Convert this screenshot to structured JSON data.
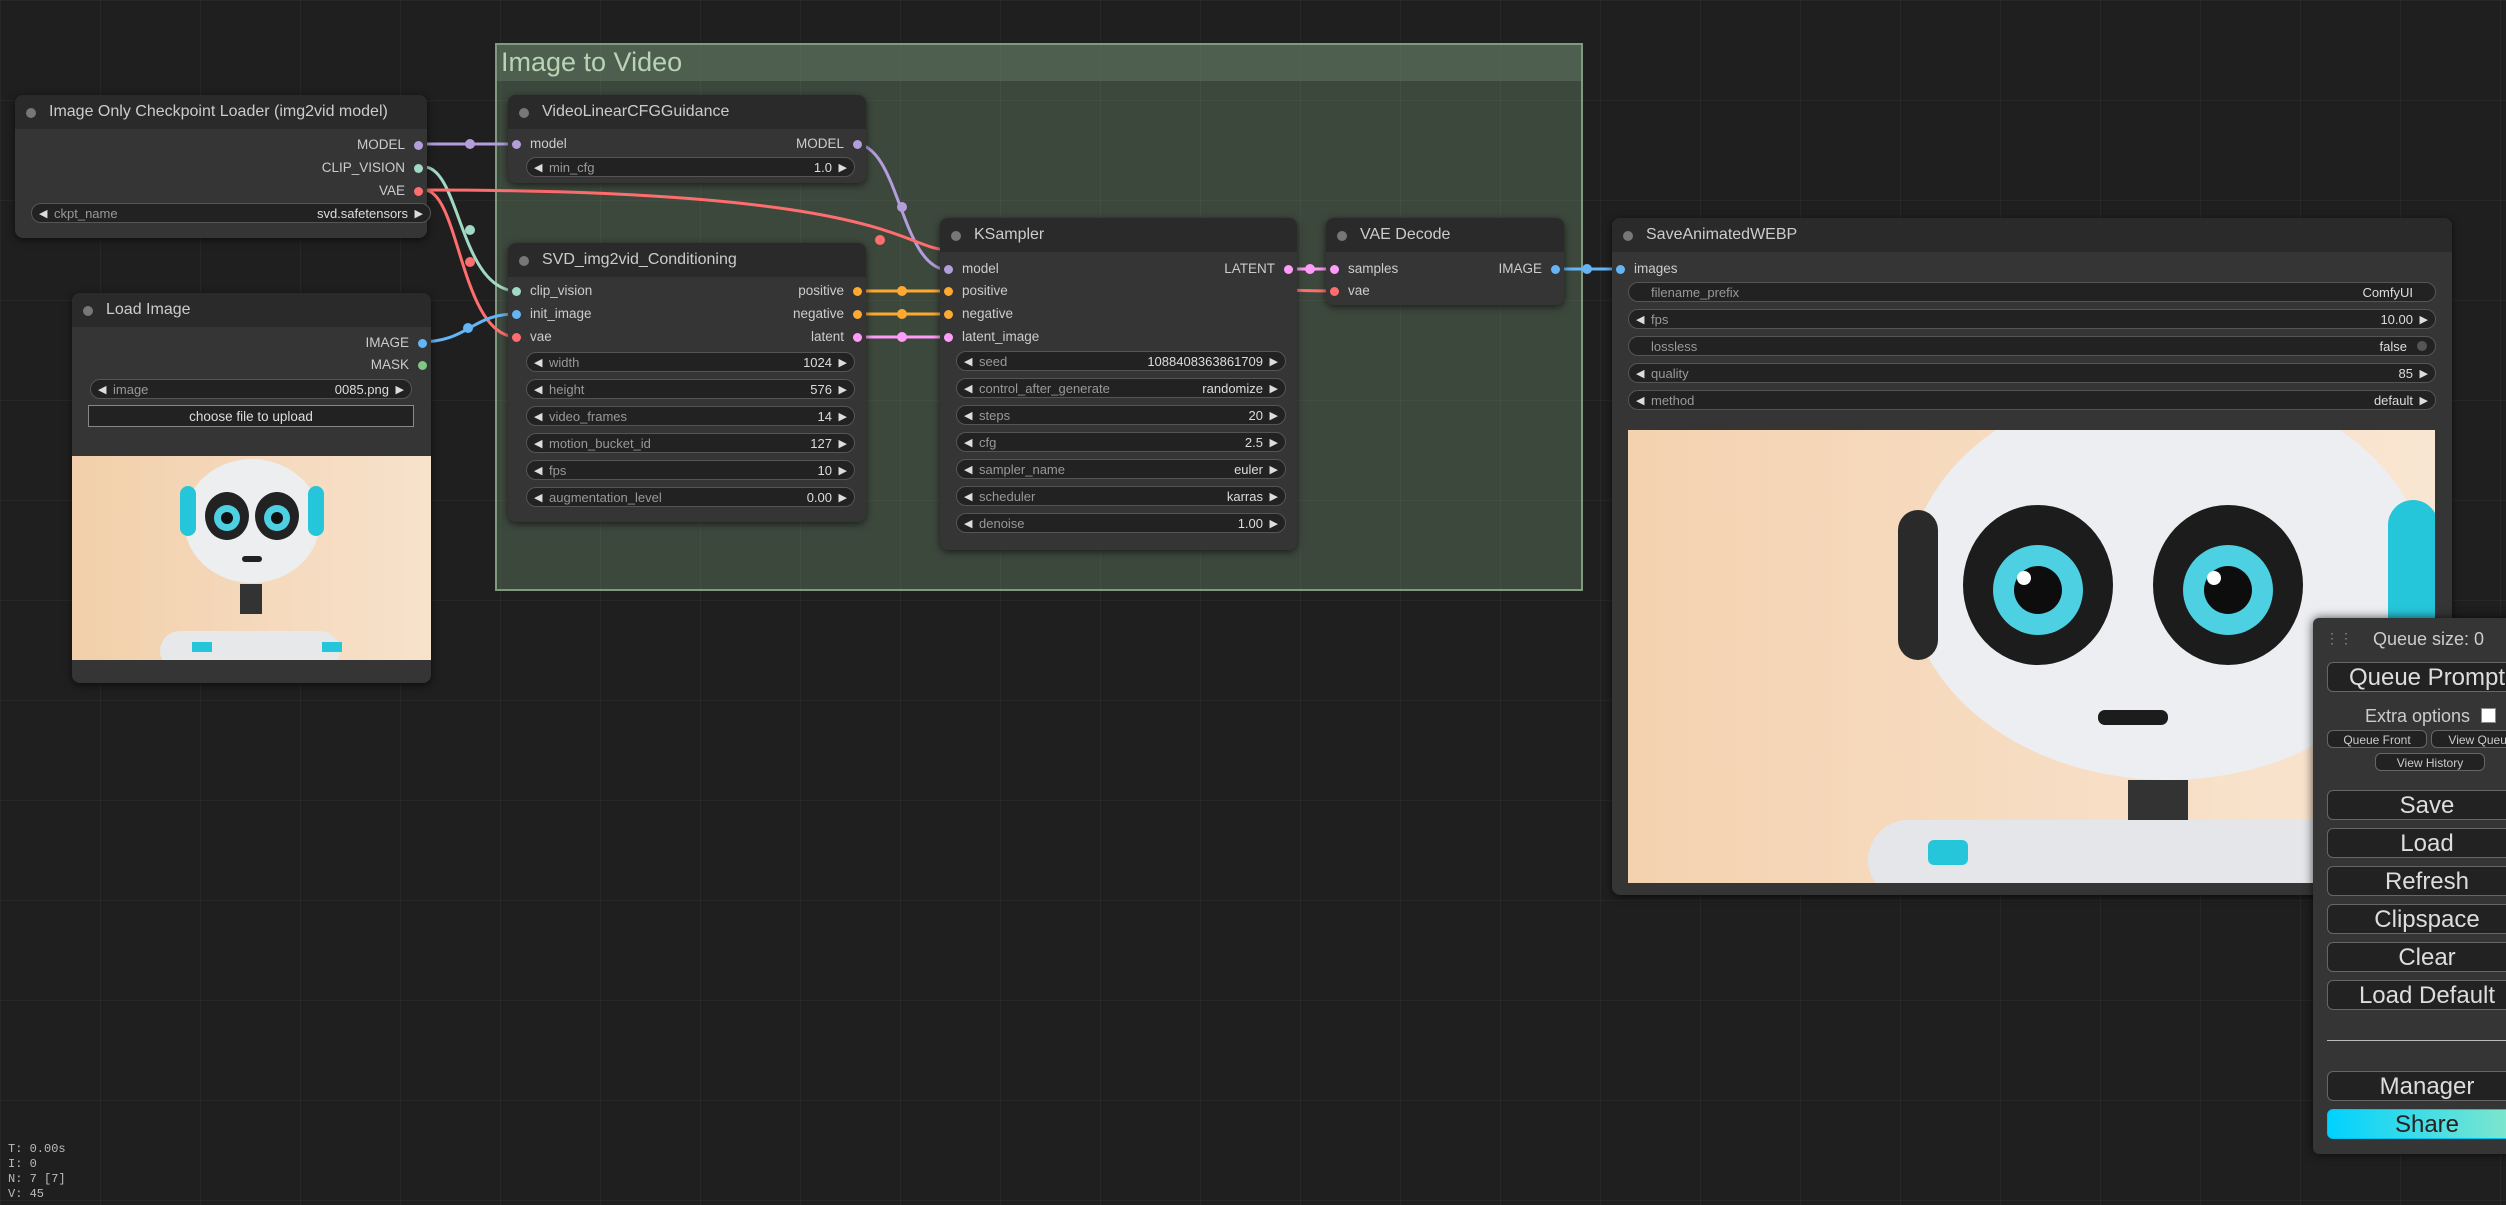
{
  "group": {
    "title": "Image to Video"
  },
  "colors": {
    "model": "#b39ddb",
    "clip_vision": "#a1d9c4",
    "vae": "#ff6e6e",
    "image": "#64b5f6",
    "conditioning": "#ffa931",
    "latent": "#ff9cf9",
    "mask": "#81c784"
  },
  "checkpoint": {
    "title": "Image Only Checkpoint Loader (img2vid model)",
    "outputs": [
      "MODEL",
      "CLIP_VISION",
      "VAE"
    ],
    "ckpt_name": {
      "label": "ckpt_name",
      "value": "svd.safetensors"
    }
  },
  "load_image": {
    "title": "Load Image",
    "outputs": [
      "IMAGE",
      "MASK"
    ],
    "image": {
      "label": "image",
      "value": "0085.png"
    },
    "upload_label": "choose file to upload"
  },
  "cfg_guidance": {
    "title": "VideoLinearCFGGuidance",
    "input": "model",
    "output": "MODEL",
    "min_cfg": {
      "label": "min_cfg",
      "value": "1.0"
    }
  },
  "conditioning": {
    "title": "SVD_img2vid_Conditioning",
    "inputs": [
      "clip_vision",
      "init_image",
      "vae"
    ],
    "outputs": [
      "positive",
      "negative",
      "latent"
    ],
    "widgets": [
      {
        "label": "width",
        "value": "1024"
      },
      {
        "label": "height",
        "value": "576"
      },
      {
        "label": "video_frames",
        "value": "14"
      },
      {
        "label": "motion_bucket_id",
        "value": "127"
      },
      {
        "label": "fps",
        "value": "10"
      },
      {
        "label": "augmentation_level",
        "value": "0.00"
      }
    ]
  },
  "ksampler": {
    "title": "KSampler",
    "inputs": [
      "model",
      "positive",
      "negative",
      "latent_image"
    ],
    "output": "LATENT",
    "widgets": [
      {
        "label": "seed",
        "value": "1088408363861709"
      },
      {
        "label": "control_after_generate",
        "value": "randomize"
      },
      {
        "label": "steps",
        "value": "20"
      },
      {
        "label": "cfg",
        "value": "2.5"
      },
      {
        "label": "sampler_name",
        "value": "euler"
      },
      {
        "label": "scheduler",
        "value": "karras"
      },
      {
        "label": "denoise",
        "value": "1.00"
      }
    ]
  },
  "vae_decode": {
    "title": "VAE Decode",
    "inputs": [
      "samples",
      "vae"
    ],
    "output": "IMAGE"
  },
  "save_webp": {
    "title": "SaveAnimatedWEBP",
    "input": "images",
    "widgets": [
      {
        "label": "filename_prefix",
        "value": "ComfyUI",
        "arrows": false
      },
      {
        "label": "fps",
        "value": "10.00",
        "arrows": true
      },
      {
        "label": "lossless",
        "value": "false",
        "toggle": true
      },
      {
        "label": "quality",
        "value": "85",
        "arrows": true
      },
      {
        "label": "method",
        "value": "default",
        "arrows": true
      }
    ]
  },
  "menu": {
    "queue_size": "Queue size: 0",
    "queue_prompt": "Queue Prompt",
    "extra_options": "Extra options",
    "queue_front": "Queue Front",
    "view_queue": "View Queue",
    "view_history": "View History",
    "save": "Save",
    "load": "Load",
    "refresh": "Refresh",
    "clipspace": "Clipspace",
    "clear": "Clear",
    "load_default": "Load Default",
    "manager": "Manager",
    "share": "Share"
  },
  "stats": {
    "t": "T: 0.00s",
    "i": "I: 0",
    "n": "N: 7 [7]",
    "v": "V: 45"
  }
}
